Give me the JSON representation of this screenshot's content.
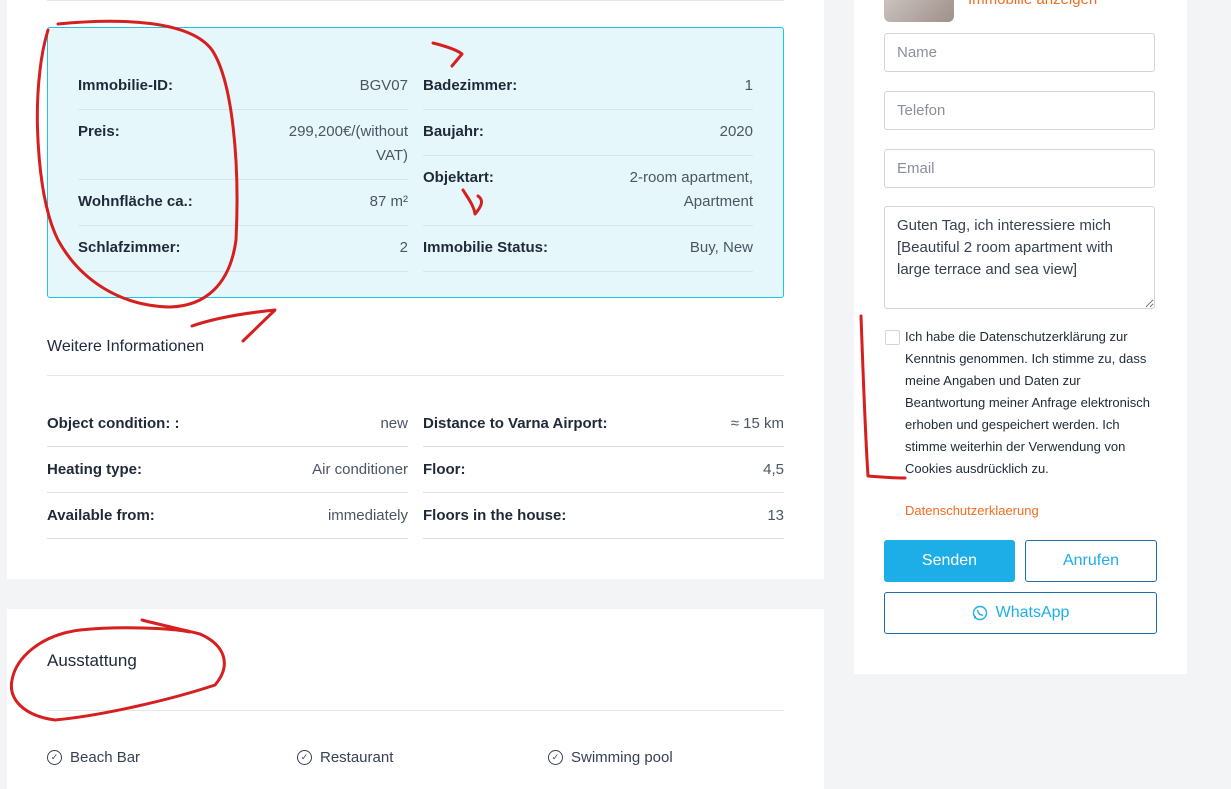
{
  "details": {
    "left": [
      {
        "label": "Immobilie-ID:",
        "value": "BGV07"
      },
      {
        "label": "Preis:",
        "value": "299,200€/(without VAT)"
      },
      {
        "label": "Wohnfläche ca.:",
        "value": "87 m²"
      },
      {
        "label": "Schlafzimmer:",
        "value": "2"
      }
    ],
    "right": [
      {
        "label": "Badezimmer:",
        "value": "1"
      },
      {
        "label": "Baujahr:",
        "value": "2020"
      },
      {
        "label": "Objektart:",
        "value": "2-room apartment, Apartment"
      },
      {
        "label": "Immobilie Status:",
        "value": "Buy, New"
      }
    ]
  },
  "more_info": {
    "title": "Weitere Informationen",
    "left": [
      {
        "label": "Object condition: :",
        "value": "new"
      },
      {
        "label": "Heating type:",
        "value": "Air conditioner"
      },
      {
        "label": "Available from:",
        "value": "immediately"
      }
    ],
    "right": [
      {
        "label": "Distance to Varna Airport:",
        "value": "≈ 15 km"
      },
      {
        "label": "Floor:",
        "value": "4,5"
      },
      {
        "label": "Floors in the house:",
        "value": "13"
      }
    ]
  },
  "features": {
    "title": "Ausstattung",
    "items": [
      "Beach Bar",
      "Restaurant",
      "Swimming pool"
    ]
  },
  "contact_form": {
    "agent_link": "Immobilie anzeigen",
    "name_placeholder": "Name",
    "phone_placeholder": "Telefon",
    "email_placeholder": "Email",
    "message_value": "Guten Tag, ich interessiere mich [Beautiful 2 room apartment with large terrace and sea view]",
    "consent_text": "Ich habe die Datenschutzerklärung zur Kenntnis genommen. Ich stimme zu, dass meine Angaben und Daten zur Beantwortung meiner Anfrage elektronisch erhoben und gespeichert werden. Ich stimme weiterhin der Verwendung von Cookies ausdrücklich zu.",
    "privacy_link": "Datenschutzerklaerung",
    "send_label": "Senden",
    "call_label": "Anrufen",
    "whatsapp_label": "WhatsApp"
  },
  "colors": {
    "accent": "#1daee8",
    "link_orange": "#f36c21",
    "details_bg": "#e6f7fc",
    "details_border": "#22c1e8",
    "annotation_red": "#d61f1f"
  },
  "icons": [
    "check-circle-icon",
    "whatsapp-icon"
  ]
}
